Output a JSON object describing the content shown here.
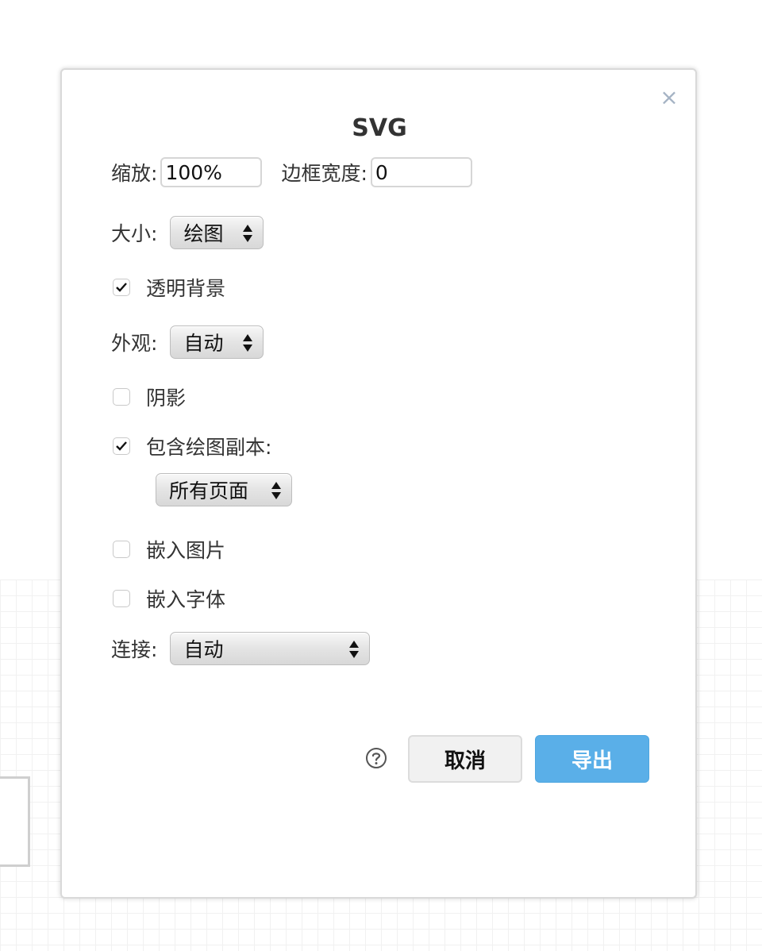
{
  "dialog": {
    "title": "SVG",
    "close_symbol": "×",
    "zoom": {
      "label": "缩放:",
      "value": "100%"
    },
    "border_width": {
      "label": "边框宽度:",
      "value": "0"
    },
    "size": {
      "label": "大小:",
      "selected": "绘图"
    },
    "transparent_bg": {
      "label": "透明背景",
      "checked": true
    },
    "appearance": {
      "label": "外观:",
      "selected": "自动"
    },
    "shadow": {
      "label": "阴影",
      "checked": false
    },
    "include_copy": {
      "label": "包含绘图副本:",
      "checked": true
    },
    "pages": {
      "selected": "所有页面"
    },
    "embed_images": {
      "label": "嵌入图片",
      "checked": false
    },
    "embed_fonts": {
      "label": "嵌入字体",
      "checked": false
    },
    "links": {
      "label": "连接:",
      "selected": "自动"
    },
    "help_icon": "question-circle-icon",
    "cancel_label": "取消",
    "export_label": "导出",
    "colors": {
      "accent": "#5aafe8",
      "close": "#a5b3c4",
      "border": "#d9d9d9"
    }
  }
}
